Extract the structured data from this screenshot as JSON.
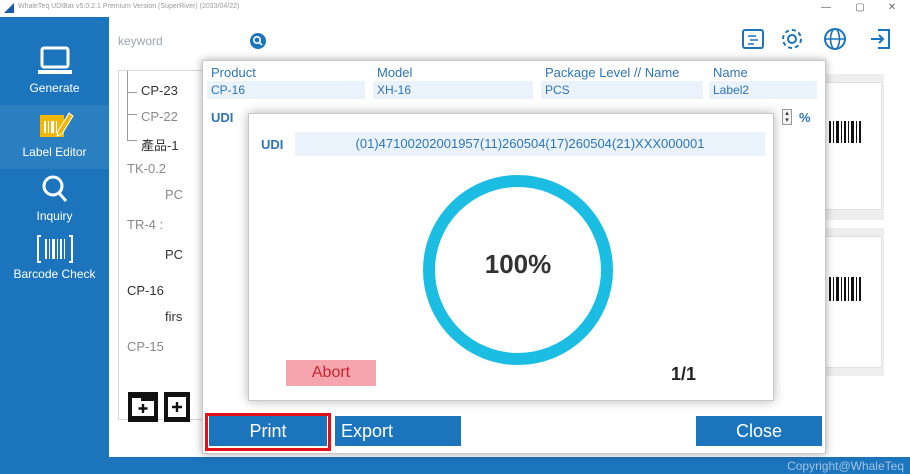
{
  "window": {
    "title": "WhaleTeq UDIBar v5.0.2.1  Premium Version  (SuperRiver) (2033/04/22)",
    "minimize_glyph": "—",
    "maximize_glyph": "▢",
    "close_glyph": "✕"
  },
  "sidebar": {
    "items": [
      {
        "label": "Generate",
        "icon": "laptop-icon"
      },
      {
        "label": "Label Editor",
        "icon": "label-edit-icon"
      },
      {
        "label": "Inquiry",
        "icon": "magnifier-icon"
      },
      {
        "label": "Barcode Check",
        "icon": "barcode-scan-icon"
      }
    ]
  },
  "search": {
    "placeholder": "keyword",
    "icon": "search-icon"
  },
  "toolbar_icons": [
    "import-icon",
    "gear-icon",
    "globe-icon",
    "logout-icon"
  ],
  "tree": {
    "rows": [
      {
        "label": "CP-23"
      },
      {
        "label": "CP-22"
      },
      {
        "label": "產品-1"
      },
      {
        "label": "TK-0.2"
      },
      {
        "label": "PC"
      },
      {
        "label": "TR-4 :"
      },
      {
        "label": "PC"
      },
      {
        "label": "CP-16"
      },
      {
        "label": "firs"
      },
      {
        "label": "CP-15"
      }
    ]
  },
  "print_dialog": {
    "product_label": "Product",
    "product_value": "CP-16",
    "model_label": "Model",
    "model_value": "XH-16",
    "package_label": "Package Level // Name",
    "package_value": "PCS",
    "name_label": "Name",
    "name_value": "Label2",
    "udi_label": "UDI",
    "percent_sign": "%",
    "print_label": "Print",
    "export_label": "Export",
    "close_label": "Close"
  },
  "progress": {
    "udi_label": "UDI",
    "udi_value": "(01)47100202001957(11)260504(17)260504(21)XXX000001",
    "percent_text": "100%",
    "percent_value": 100,
    "abort_label": "Abort",
    "count_text": "1/1"
  },
  "footer": {
    "copyright": "Copyright@WhaleTeq"
  },
  "colors": {
    "brand_blue": "#1c75bc",
    "ring_cyan": "#1cbde3",
    "abort_bg": "#f6a4ae",
    "highlight_red": "#e3101a"
  }
}
